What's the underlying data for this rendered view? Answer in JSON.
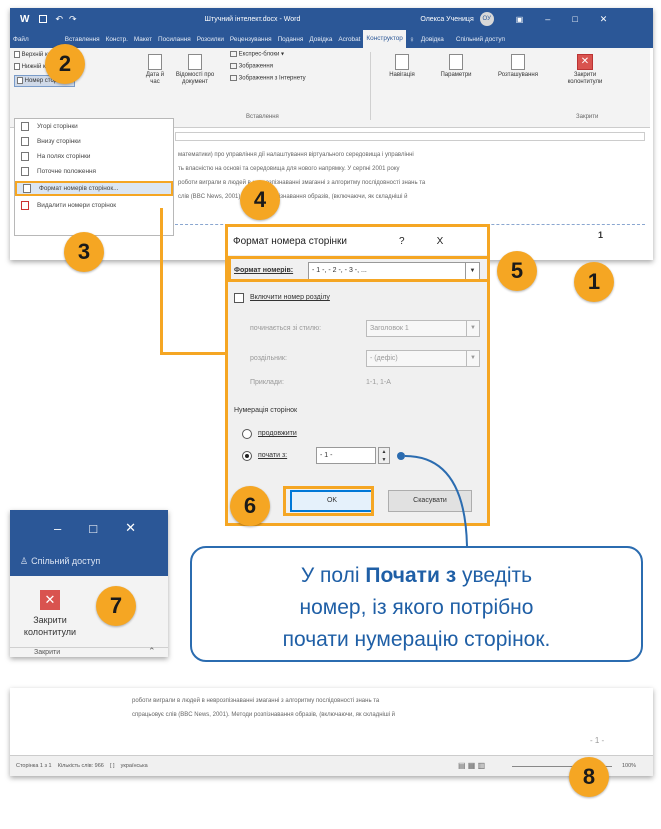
{
  "window": {
    "title": "Штучний інтелект.docx - Word",
    "user": "Олекса Учениця",
    "user_initials": "ОУ",
    "qat_icons": [
      "word-icon",
      "save-icon",
      "undo-icon",
      "redo-icon"
    ]
  },
  "tabs": [
    {
      "label": "Файл"
    },
    {
      "label": "Вставлення"
    },
    {
      "label": "Констр."
    },
    {
      "label": "Макет"
    },
    {
      "label": "Посилання"
    },
    {
      "label": "Розсилки"
    },
    {
      "label": "Рецензування"
    },
    {
      "label": "Подання"
    },
    {
      "label": "Довідка"
    },
    {
      "label": "Acrobat"
    },
    {
      "label": "Конструктор"
    },
    {
      "label": "Довідка"
    },
    {
      "label": "Спільний доступ"
    }
  ],
  "ribbon": {
    "btn_header": "Верхній колонтитул",
    "btn_footer": "Нижній колонтитул",
    "btn_pagenum": "Номер сторінки",
    "date_label": "Дата й час",
    "docinfo_label": "Відомості про документ",
    "express_label": "Експрес-блоки",
    "images_label": "Зображення",
    "online_images_label": "Зображення з Інтернету",
    "insert_group": "Вставлення",
    "nav_label": "Навігація",
    "params_label": "Параметри",
    "position_label": "Розташування",
    "close_label": "Закрити колонтитули",
    "close_group": "Закрити"
  },
  "menu": [
    {
      "label": "Угорі сторінки"
    },
    {
      "label": "Внизу сторінки"
    },
    {
      "label": "На полях сторінки"
    },
    {
      "label": "Поточне положення"
    },
    {
      "label": "Формат номерів сторінок..."
    },
    {
      "label": "Видалити номери сторінок"
    }
  ],
  "doc_lines": [
    "математики) про управління дії налаштування віртуального середовища і управлінні",
    "ть власністю на основі та середовища для нового напрямку. У серпні 2001 року",
    "роботи виграли в людей в неврозпізнаванні змаганні з алгоритму послідовності знань та",
    "слів (BBC News, 2001). Методи розпізнавання образів, (включаючи, як складніші й"
  ],
  "dialog": {
    "title": "Формат номера сторінки",
    "help": "?",
    "close": "X",
    "format_label": "Формат номерів:",
    "format_value": "- 1 -, - 2 -, - 3 -, ...",
    "chapter_check": "Включити номер розділу",
    "chapter_style_label": "починається зі стилю:",
    "chapter_style_value": "Заголовок 1",
    "separator_label": "роздільник:",
    "separator_value": "-   (дефіс)",
    "example_label": "Приклади:",
    "example_value": "1-1, 1-A",
    "numbering_label": "Нумерація сторінок",
    "continue_label": "продовжити",
    "start_label": "почати з:",
    "start_value": "- 1 -",
    "ok": "OK",
    "cancel": "Скасувати"
  },
  "close_panel": {
    "share": "Спільний доступ",
    "close_label": "Закрити колонтитули",
    "group": "Закрити",
    "controls": [
      "–",
      "□",
      "✕"
    ]
  },
  "callout": {
    "line1_pre": "У полі ",
    "line1_bold": "Почати з",
    "line1_post": " уведіть",
    "line2": "номер, із якого потрібно",
    "line3": "почати нумерацію сторінок."
  },
  "bottom": {
    "line1": "роботи виграли в людей в неврозпізнаванні змаганні з алгоритму послідовності знань та",
    "line2": "спрацьовує слів (BBC News, 2001). Методи розпізнавання образів, (включаючи, як складніші й",
    "status_left": "Сторінка 1 з 1    Кількість слів: 966    [ ]    українська",
    "page_mark": "- 1 -",
    "zoom": "100%"
  },
  "page_number_mark": "1",
  "badges": [
    "1",
    "2",
    "3",
    "4",
    "5",
    "6",
    "7",
    "8"
  ],
  "colors": {
    "word_blue": "#2b5797",
    "accent_orange": "#f5a623",
    "callout_blue": "#1f5fa6",
    "close_red": "#d9534f"
  }
}
